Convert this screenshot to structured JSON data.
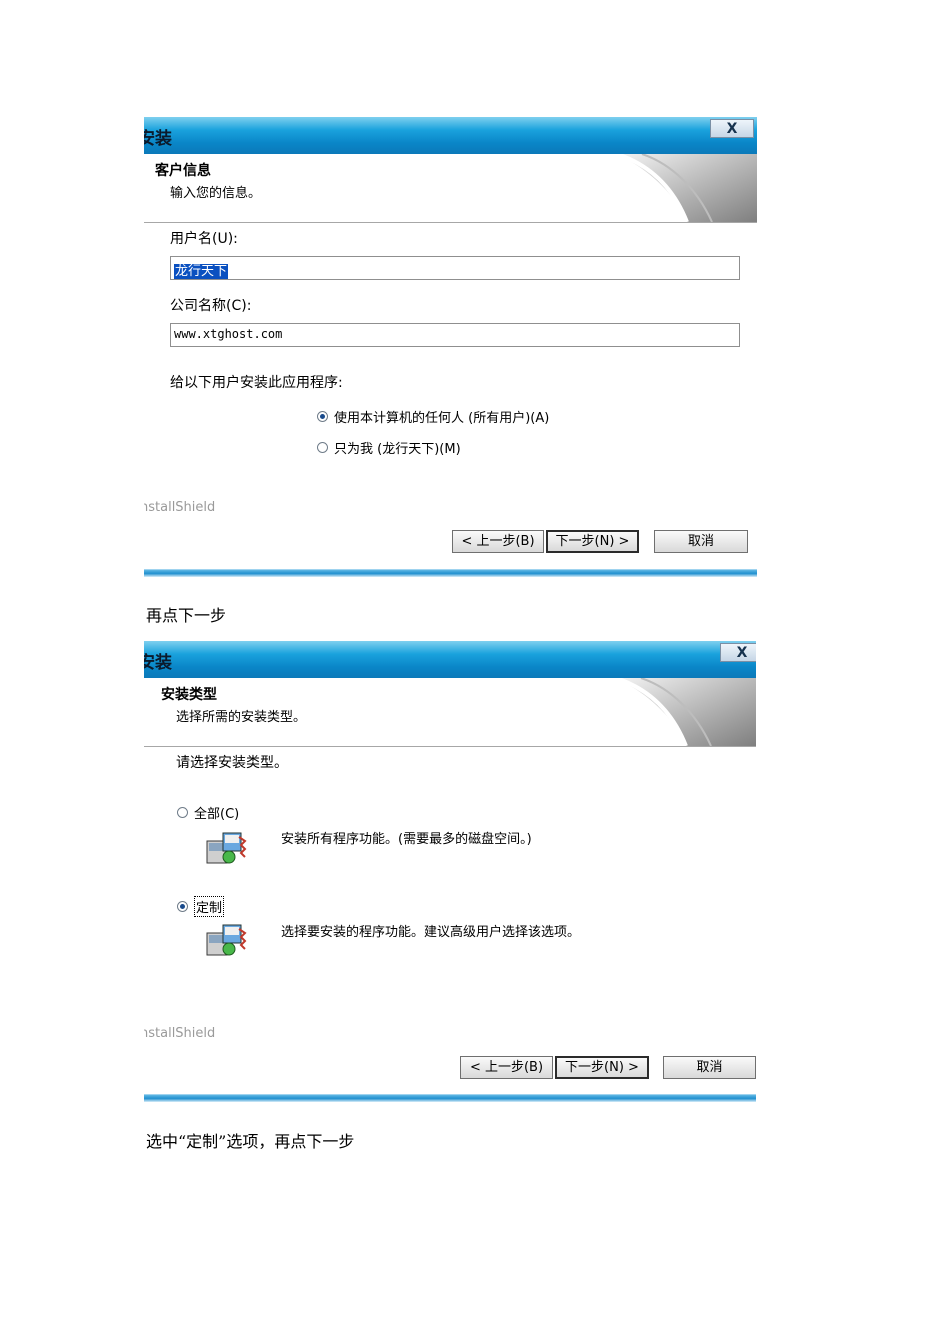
{
  "dialog1": {
    "title": "安装",
    "close_label": "X",
    "header_title": "客户信息",
    "header_subtitle": "输入您的信息。",
    "username_label": "用户名(U):",
    "username_value": "龙行天下",
    "company_label": "公司名称(C):",
    "company_value": "www.xtghost.com",
    "install_for_label": "给以下用户安装此应用程序:",
    "radio_all_users": "使用本计算机的任何人 (所有用户)(A)",
    "radio_only_me": "只为我 (龙行天下)(M)",
    "brand": "nstallShield",
    "back_button": "< 上一步(B)",
    "next_button": "下一步(N) >",
    "cancel_button": "取消"
  },
  "caption1": "再点下一步",
  "dialog2": {
    "title": "安装",
    "close_label": "X",
    "header_title": "安装类型",
    "header_subtitle": "选择所需的安装类型。",
    "prompt": "请选择安装类型。",
    "option_complete_label": "全部(C)",
    "option_complete_desc": "安装所有程序功能。(需要最多的磁盘空间。)",
    "option_custom_label": "定制",
    "option_custom_desc": "选择要安装的程序功能。建议高级用户选择该选项。",
    "brand": "nstallShield",
    "back_button": "< 上一步(B)",
    "next_button": "下一步(N) >",
    "cancel_button": "取消"
  },
  "caption2": "选中“定制”选项，再点下一步"
}
